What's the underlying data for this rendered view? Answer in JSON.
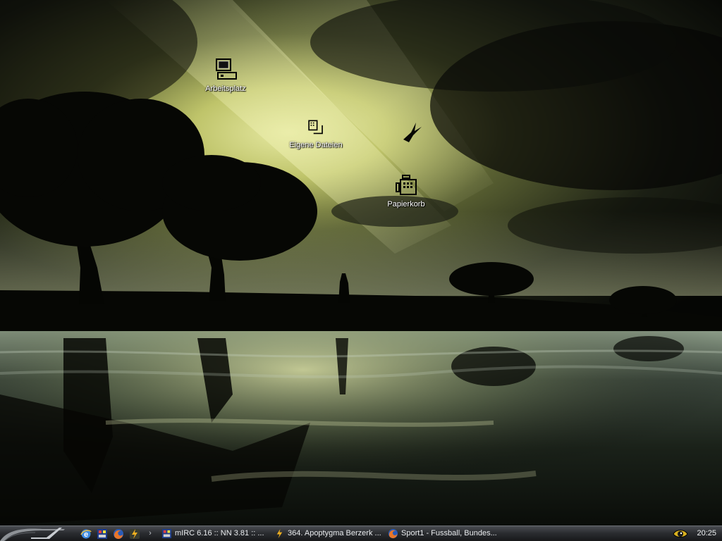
{
  "colors": {
    "sky_glow": "#d8dc8c",
    "sky_dark": "#0b0d08",
    "silhouette": "#060704",
    "taskbar_top": "#4a4d52",
    "taskbar_bottom": "#17181a",
    "label_text": "#ffffff"
  },
  "desktop": {
    "icons": [
      {
        "label": "Arbeitsplatz",
        "icon": "my-computer-icon"
      },
      {
        "label": "Eigene Dateien",
        "icon": "my-documents-icon"
      },
      {
        "label": "Papierkorb",
        "icon": "recycle-bin-icon"
      }
    ]
  },
  "taskbar": {
    "start_icon": "start-swoosh-icon",
    "quick_launch": [
      {
        "icon": "internet-explorer-icon"
      },
      {
        "icon": "mirc-icon"
      },
      {
        "icon": "firefox-icon"
      },
      {
        "icon": "winamp-icon"
      }
    ],
    "quick_launch_more": "›",
    "tasks": [
      {
        "label": "mIRC 6.16 :: NN 3.81 :: ...",
        "icon": "mirc-icon"
      },
      {
        "label": "364. Apoptygma Berzerk ...",
        "icon": "winamp-icon"
      },
      {
        "label": "Sport1 - Fussball, Bundes...",
        "icon": "firefox-icon"
      }
    ],
    "tray_icon": "eye-tray-icon",
    "clock": "20:25"
  }
}
